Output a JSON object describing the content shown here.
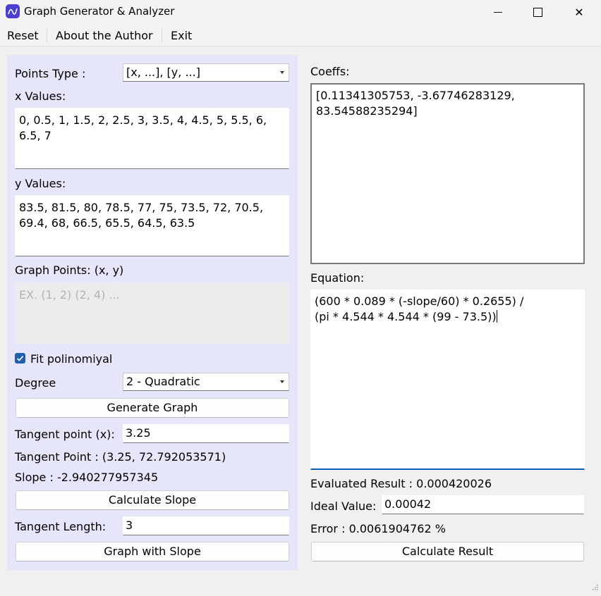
{
  "window": {
    "title": "Graph Generator & Analyzer",
    "minimize_glyph": "—",
    "close_glyph": "✕"
  },
  "menu": {
    "reset": "Reset",
    "about": "About the Author",
    "exit": "Exit"
  },
  "left": {
    "points_type_label": "Points Type :",
    "points_type_value": "[x, ...], [y, ...]",
    "x_values_label": "x Values:",
    "x_values": "0, 0.5, 1, 1.5, 2, 2.5, 3, 3.5, 4, 4.5, 5, 5.5, 6, 6.5, 7",
    "y_values_label": "y Values:",
    "y_values": "83.5, 81.5, 80, 78.5, 77, 75, 73.5, 72, 70.5, 69.4, 68, 66.5, 65.5, 64.5, 63.5",
    "graph_points_label": "Graph Points: (x, y)",
    "graph_points_placeholder": "EX. (1, 2) (2, 4) ...",
    "fit_label": "Fit polinomiyal",
    "fit_checked": true,
    "degree_label": "Degree",
    "degree_value": "2 - Quadratic",
    "generate_button": "Generate Graph",
    "tangent_x_label": "Tangent point (x):",
    "tangent_x_value": "3.25",
    "tangent_point_text": "Tangent Point : (3.25, 72.792053571)",
    "slope_text": "Slope : -2.940277957345",
    "calc_slope_button": "Calculate Slope",
    "tangent_length_label": "Tangent Length:",
    "tangent_length_value": "3",
    "graph_slope_button": "Graph with Slope"
  },
  "right": {
    "coeffs_label": "Coeffs:",
    "coeffs_value": "[0.11341305753, -3.67746283129, 83.54588235294]",
    "equation_label": "Equation:",
    "equation_line1": "(600 * 0.089 * (-slope/60) * 0.2655) /",
    "equation_line2": "(pi * 4.544 * 4.544 * (99 - 73.5))",
    "evaluated_text": "Evaluated Result : 0.000420026",
    "ideal_label": "Ideal Value:",
    "ideal_value": "0.00042",
    "error_text": "Error : 0.0061904762 %",
    "calc_result_button": "Calculate Result"
  },
  "colors": {
    "panel_bg": "#e6e6fa",
    "accent": "#1f5fb0",
    "app_icon": "#4b3fd1"
  }
}
